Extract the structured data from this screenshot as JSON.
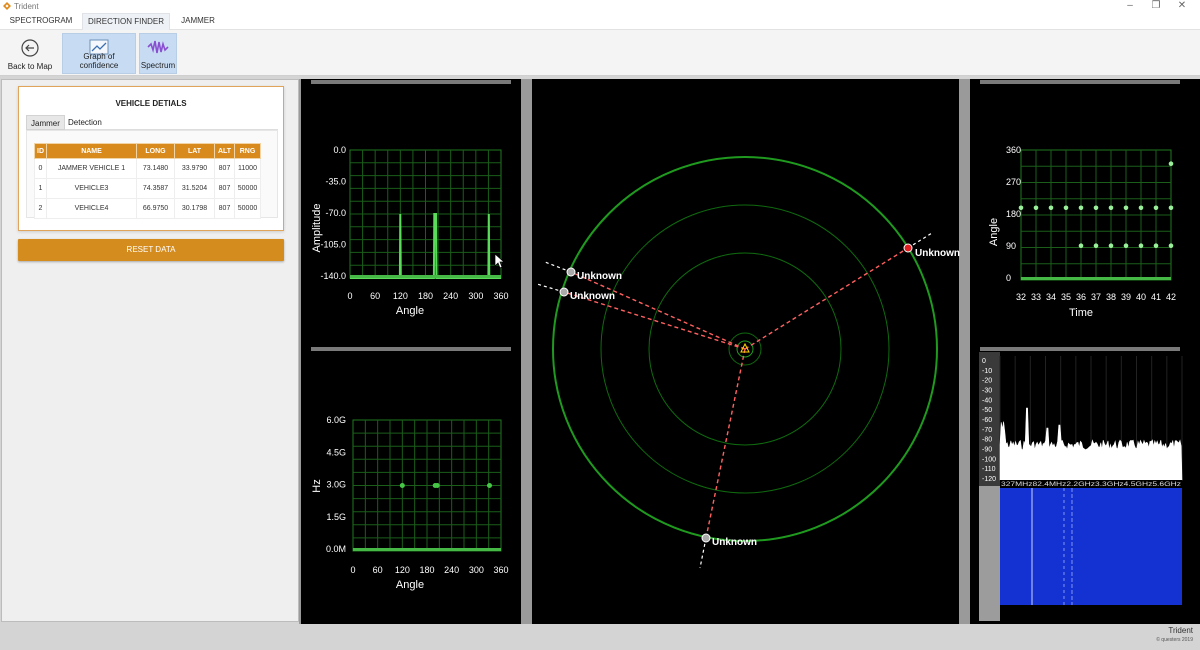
{
  "window": {
    "title": "Trident"
  },
  "tabs": [
    {
      "label": "SPECTROGRAM"
    },
    {
      "label": "DIRECTION FINDER"
    },
    {
      "label": "JAMMER"
    }
  ],
  "ribbon": {
    "back_label": "Back to Map",
    "confidence_label": "Graph of confidence",
    "spectrum_label": "Spectrum"
  },
  "vehicle_card": {
    "title": "VEHICLE DETIALS",
    "subtabs": [
      "Jammer",
      "Detection"
    ],
    "columns": [
      "ID",
      "NAME",
      "LONG",
      "LAT",
      "ALT",
      "RNG"
    ],
    "rows": [
      [
        "0",
        "JAMMER VEHICLE 1",
        "73.1480",
        "33.9790",
        "807",
        "11000"
      ],
      [
        "1",
        "VEHICLE3",
        "74.3587",
        "31.5204",
        "807",
        "50000"
      ],
      [
        "2",
        "VEHICLE4",
        "66.9750",
        "30.1798",
        "807",
        "50000"
      ]
    ]
  },
  "reset_label": "RESET DATA",
  "amplitude_chart": {
    "ylabel": "Amplitude",
    "xlabel": "Angle",
    "yticks": [
      "0.0",
      "-35.0",
      "-70.0",
      "-105.0",
      "-140.0"
    ],
    "xticks": [
      "0",
      "60",
      "120",
      "180",
      "240",
      "300",
      "360"
    ]
  },
  "freq_chart": {
    "ylabel": "Hz",
    "xlabel": "Angle",
    "yticks": [
      "6.0G",
      "4.5G",
      "3.0G",
      "1.5G",
      "0.0M"
    ],
    "xticks": [
      "0",
      "60",
      "120",
      "180",
      "240",
      "300",
      "360"
    ]
  },
  "radar": {
    "targets": [
      {
        "label": "Unknown"
      },
      {
        "label": "Unknown"
      },
      {
        "label": "Unknown"
      },
      {
        "label": "Unknown"
      }
    ]
  },
  "angle_time_chart": {
    "ylabel": "Angle",
    "xlabel": "Time",
    "yticks": [
      "360",
      "270",
      "180",
      "90",
      "0"
    ],
    "xticks": [
      "32",
      "33",
      "34",
      "35",
      "36",
      "37",
      "38",
      "39",
      "40",
      "41",
      "42"
    ]
  },
  "spectrum_chart": {
    "yticks": [
      "0",
      "-10",
      "-20",
      "-30",
      "-40",
      "-50",
      "-60",
      "-70",
      "-80",
      "-90",
      "-100",
      "-110",
      "-120"
    ]
  },
  "footer": {
    "app_name": "Trident",
    "copyright": "© questers 2019"
  },
  "colors": {
    "accent": "#d98a1c",
    "green": "#32c832",
    "target_red": "#e02020",
    "waterfall_blue": "#1432d2"
  },
  "chart_data": [
    {
      "type": "line",
      "ylabel": "Amplitude",
      "xlabel": "Angle",
      "xlim": [
        0,
        360
      ],
      "ylim": [
        -140,
        0
      ],
      "series": [
        {
          "x": [
            0,
            119,
            120,
            121,
            200,
            201,
            205,
            206,
            330,
            331,
            332,
            360
          ],
          "y": [
            -140,
            -140,
            -70,
            -140,
            -140,
            -70,
            -70,
            -140,
            -140,
            -70,
            -140,
            -140
          ]
        }
      ]
    },
    {
      "type": "scatter",
      "ylabel": "Hz",
      "xlabel": "Angle",
      "xlim": [
        0,
        360
      ],
      "ylim": [
        0,
        6000000000
      ],
      "series": [
        {
          "x": [
            120,
            200,
            205,
            332
          ],
          "y": [
            3000000000,
            3000000000,
            3000000000,
            3000000000
          ]
        }
      ]
    },
    {
      "type": "scatter",
      "ylabel": "Angle",
      "xlabel": "Time",
      "xlim": [
        32,
        42
      ],
      "ylim": [
        0,
        360
      ],
      "series": [
        {
          "x": [
            32,
            33,
            34,
            35,
            36,
            37,
            38,
            39,
            40,
            41,
            42
          ],
          "y": [
            200,
            200,
            200,
            200,
            200,
            200,
            200,
            200,
            200,
            200,
            200
          ]
        },
        {
          "x": [
            36,
            37,
            38,
            39,
            40,
            41,
            42
          ],
          "y": [
            95,
            95,
            95,
            95,
            95,
            95,
            95
          ]
        },
        {
          "x": [
            42
          ],
          "y": [
            322
          ]
        }
      ]
    }
  ]
}
